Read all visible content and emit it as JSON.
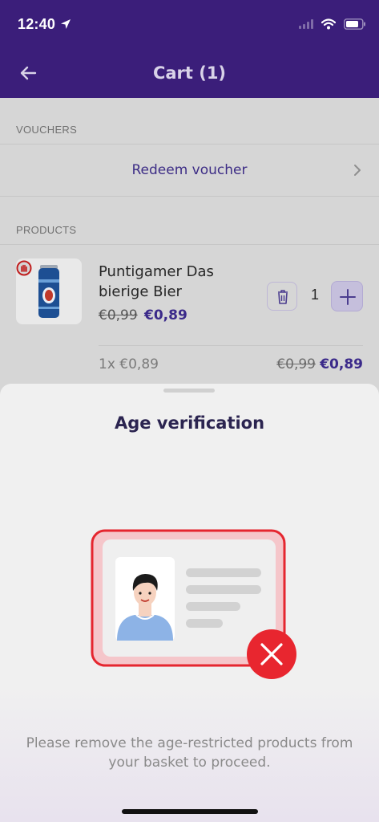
{
  "status_bar": {
    "time": "12:40"
  },
  "header": {
    "title": "Cart (1)"
  },
  "vouchers": {
    "section_label": "VOUCHERS",
    "redeem_label": "Redeem voucher"
  },
  "products": {
    "section_label": "PRODUCTS",
    "items": [
      {
        "name": "Puntigamer Das bierige Bier",
        "price_old": "€0,99",
        "price_new": "€0,89",
        "quantity": "1"
      }
    ]
  },
  "summary": {
    "quantity_text": "1x €0,89",
    "price_old": "€0,99",
    "price_new": "€0,89"
  },
  "sheet": {
    "title": "Age verification",
    "message": "Please remove the age-restricted products from your basket to proceed."
  },
  "colors": {
    "brand": "#3b1e7a",
    "accent": "#3b2a8a",
    "error": "#e8262f"
  },
  "icons": [
    "location-arrow-icon",
    "signal-icon",
    "wifi-icon",
    "battery-icon",
    "back-arrow-icon",
    "chevron-right-icon",
    "age-restriction-icon",
    "trash-icon",
    "plus-icon",
    "id-card-icon",
    "close-x-icon"
  ]
}
